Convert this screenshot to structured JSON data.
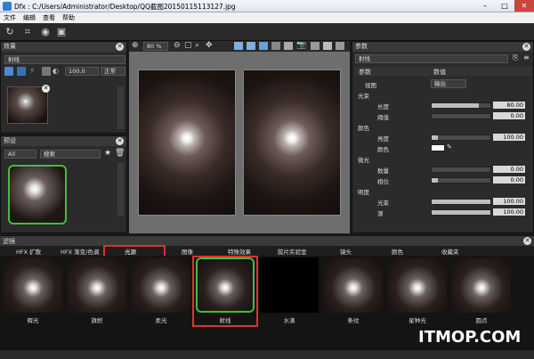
{
  "window": {
    "title": "Dfx : C:/Users/Administrator/Desktop/QQ截图20150115113127.jpg",
    "min": "–",
    "max": "□",
    "close": "✕"
  },
  "menu": [
    "文件",
    "编辑",
    "查看",
    "帮助"
  ],
  "effects_panel": {
    "title": "效果",
    "effect_name": "射线",
    "opacity": "100.0",
    "blend_mode": "正常"
  },
  "presets_panel": {
    "title": "预设",
    "category": "All",
    "search_placeholder": "搜索"
  },
  "zoom": {
    "value": "80 %"
  },
  "params_panel": {
    "title": "参数",
    "effect_name": "射线",
    "col_param": "参数",
    "col_value": "数值",
    "rows": [
      {
        "label": "视图",
        "value": "输出"
      },
      {
        "label": "光束"
      },
      {
        "label": "长度",
        "value": "80.00",
        "level": 0.8
      },
      {
        "label": "阈值",
        "value": "0.00",
        "level": 0.0
      },
      {
        "label": "颜色"
      },
      {
        "label": "亮度",
        "value": "100.00",
        "level": 0.1
      },
      {
        "label": "颜色"
      },
      {
        "label": "微光"
      },
      {
        "label": "数量",
        "value": "0.00",
        "level": 0.0
      },
      {
        "label": "相位",
        "value": "0.00",
        "level": 0.1
      },
      {
        "label": "明度"
      },
      {
        "label": "光束",
        "value": "100.00",
        "level": 1.0
      },
      {
        "label": "源",
        "value": "100.00",
        "level": 1.0
      }
    ]
  },
  "filters": {
    "title": "滤镜",
    "tabs": [
      "HFX 扩散",
      "HFX 渐变/色调",
      "光源",
      "图像",
      "特殊效果",
      "胶片实验室",
      "镜头",
      "颜色",
      "收藏夹"
    ],
    "items": [
      "辉光",
      "旗帜",
      "柔光",
      "射线",
      "水滴",
      "条纹",
      "星种光",
      "圆点"
    ]
  },
  "watermark": "ITMOP.COM",
  "colors": {
    "accent_green": "#3fbf3f",
    "highlight_red": "#e03030"
  }
}
